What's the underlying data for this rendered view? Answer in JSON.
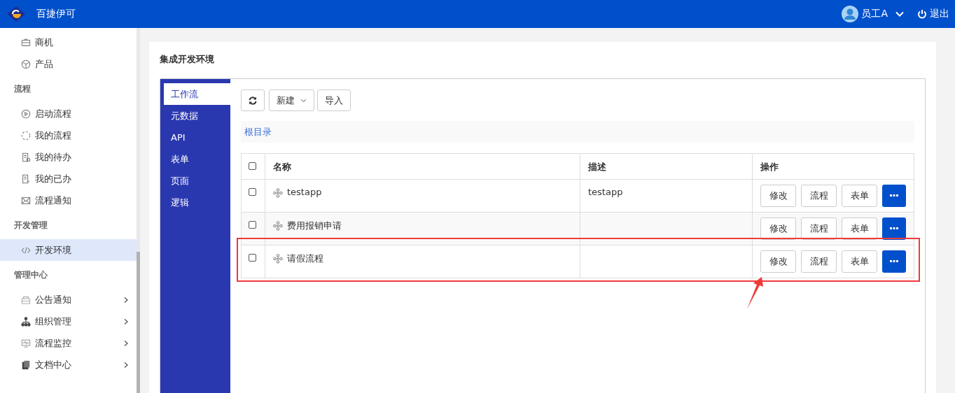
{
  "header": {
    "brand": "百捷伊可",
    "user": "员工A",
    "logout": "退出"
  },
  "sidebar": {
    "items": [
      {
        "kind": "item",
        "label": "商机",
        "selected": false,
        "has_submenu": false
      },
      {
        "kind": "item",
        "label": "产品",
        "selected": false,
        "has_submenu": false
      },
      {
        "kind": "header",
        "label": "流程"
      },
      {
        "kind": "item",
        "label": "启动流程",
        "selected": false,
        "has_submenu": false
      },
      {
        "kind": "item",
        "label": "我的流程",
        "selected": false,
        "has_submenu": false
      },
      {
        "kind": "item",
        "label": "我的待办",
        "selected": false,
        "has_submenu": false
      },
      {
        "kind": "item",
        "label": "我的已办",
        "selected": false,
        "has_submenu": false
      },
      {
        "kind": "item",
        "label": "流程通知",
        "selected": false,
        "has_submenu": false
      },
      {
        "kind": "header",
        "label": "开发管理"
      },
      {
        "kind": "item",
        "label": "开发环境",
        "selected": true,
        "has_submenu": false
      },
      {
        "kind": "header",
        "label": "管理中心"
      },
      {
        "kind": "item",
        "label": "公告通知",
        "selected": false,
        "has_submenu": true
      },
      {
        "kind": "item",
        "label": "组织管理",
        "selected": false,
        "has_submenu": true
      },
      {
        "kind": "item",
        "label": "流程监控",
        "selected": false,
        "has_submenu": true
      },
      {
        "kind": "item",
        "label": "文档中心",
        "selected": false,
        "has_submenu": true
      }
    ]
  },
  "page": {
    "title": "集成开发环境"
  },
  "tabs": [
    {
      "label": "工作流",
      "selected": true
    },
    {
      "label": "元数据",
      "selected": false
    },
    {
      "label": "API",
      "selected": false
    },
    {
      "label": "表单",
      "selected": false
    },
    {
      "label": "页面",
      "selected": false
    },
    {
      "label": "逻辑",
      "selected": false
    }
  ],
  "toolbar": {
    "new": "新建",
    "import": "导入"
  },
  "breadcrumb": "根目录",
  "table": {
    "columns": [
      "名称",
      "描述",
      "操作"
    ],
    "select_all_checked": false,
    "rows": [
      {
        "name": "testapp",
        "description": "testapp",
        "checked": false,
        "highlighted": false,
        "actions": [
          "修改",
          "流程",
          "表单"
        ]
      },
      {
        "name": "费用报销申请",
        "description": "",
        "checked": false,
        "highlighted": false,
        "actions": [
          "修改",
          "流程",
          "表单"
        ]
      },
      {
        "name": "请假流程",
        "description": "",
        "checked": false,
        "highlighted": true,
        "actions": [
          "修改",
          "流程",
          "表单"
        ]
      }
    ]
  }
}
